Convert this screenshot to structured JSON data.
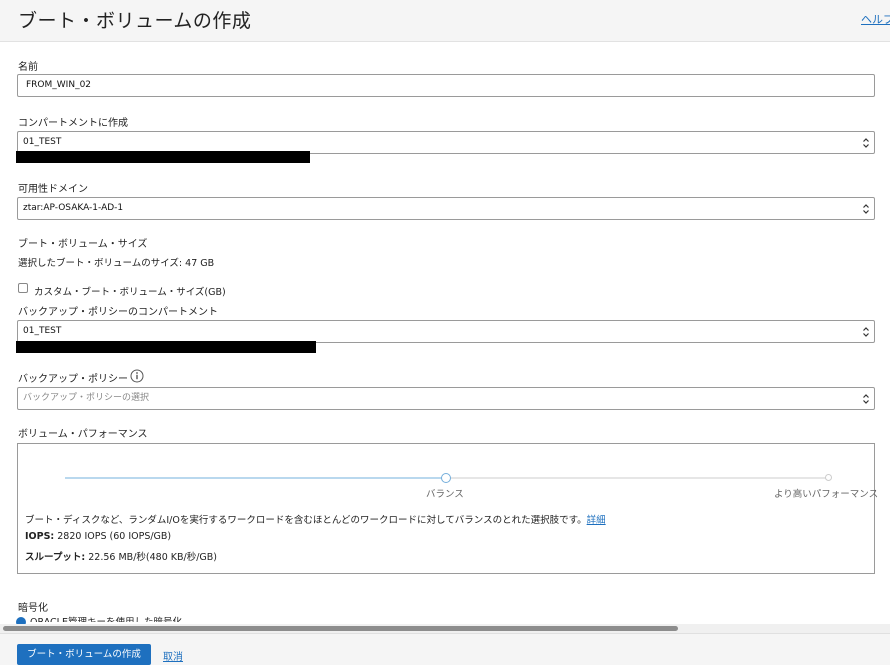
{
  "page": {
    "title": "ブート・ボリュームの作成",
    "help_label": "ヘルプ"
  },
  "form": {
    "name": {
      "label": "名前",
      "value": "FROM_WIN_02"
    },
    "compartment": {
      "label": "コンパートメントに作成",
      "value": "01_TEST"
    },
    "availability_domain": {
      "label": "可用性ドメイン",
      "value": "ztar:AP-OSAKA-1-AD-1"
    },
    "boot_volume_size": {
      "label": "ブート・ボリューム・サイズ",
      "selected_text": "選択したブート・ボリュームのサイズ: 47 GB"
    },
    "custom_size": {
      "label": "カスタム・ブート・ボリューム・サイズ(GB)",
      "checked": false
    },
    "backup_policy_compartment": {
      "label": "バックアップ・ポリシーのコンパートメント",
      "value": "01_TEST"
    },
    "backup_policy": {
      "label": "バックアップ・ポリシー",
      "placeholder": "バックアップ・ポリシーの選択",
      "info_icon": "info-icon"
    },
    "volume_performance": {
      "label": "ボリューム・パフォーマンス",
      "levels": [
        "バランス",
        "より高いパフォーマンス"
      ],
      "selected_level": "バランス",
      "description": "ブート・ディスクなど、ランダムI/Oを実行するワークロードを含むほとんどのワークロードに対してバランスのとれた選択肢です。",
      "details_link": "詳細",
      "iops_label": "IOPS:",
      "iops_value": "2820 IOPS (60 IOPS/GB)",
      "throughput_label": "スループット:",
      "throughput_value": "22.56 MB/秒(480 KB/秒/GB)"
    },
    "encryption": {
      "label": "暗号化",
      "selected_option": "ORACLE管理キーを使用した暗号化"
    }
  },
  "footer": {
    "create_button": "ブート・ボリュームの作成",
    "cancel_link": "取消"
  },
  "colors": {
    "accent": "#1e70bf",
    "slider_fill": "#b9d8ee",
    "header_bg": "#f5f5f5",
    "border": "#9a9a9a"
  }
}
